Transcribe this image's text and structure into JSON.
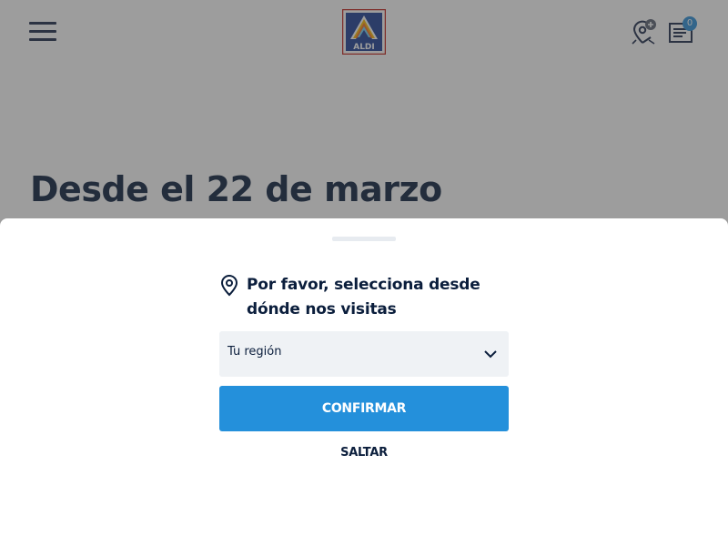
{
  "header": {
    "menu_icon": "hamburger-menu-icon",
    "logo_text": "ALDI",
    "store_icon": "store-location-add-icon",
    "list_icon": "shopping-list-icon",
    "list_count": "0"
  },
  "hero": {
    "title": "Desde el 22 de marzo"
  },
  "region_sheet": {
    "prompt": "Por favor, selecciona desde dónde nos visitas",
    "prompt_icon": "location-pin-icon",
    "select_value": "Tu región",
    "select_icon": "chevron-down-icon",
    "confirm_label": "CONFIRMAR",
    "skip_label": "SALTAR"
  },
  "colors": {
    "brand_navy": "#0b1e3c",
    "accent_blue": "#2490db",
    "badge_blue": "#2a8fd8",
    "input_bg": "#eff2f5",
    "overlay": "#999999"
  }
}
